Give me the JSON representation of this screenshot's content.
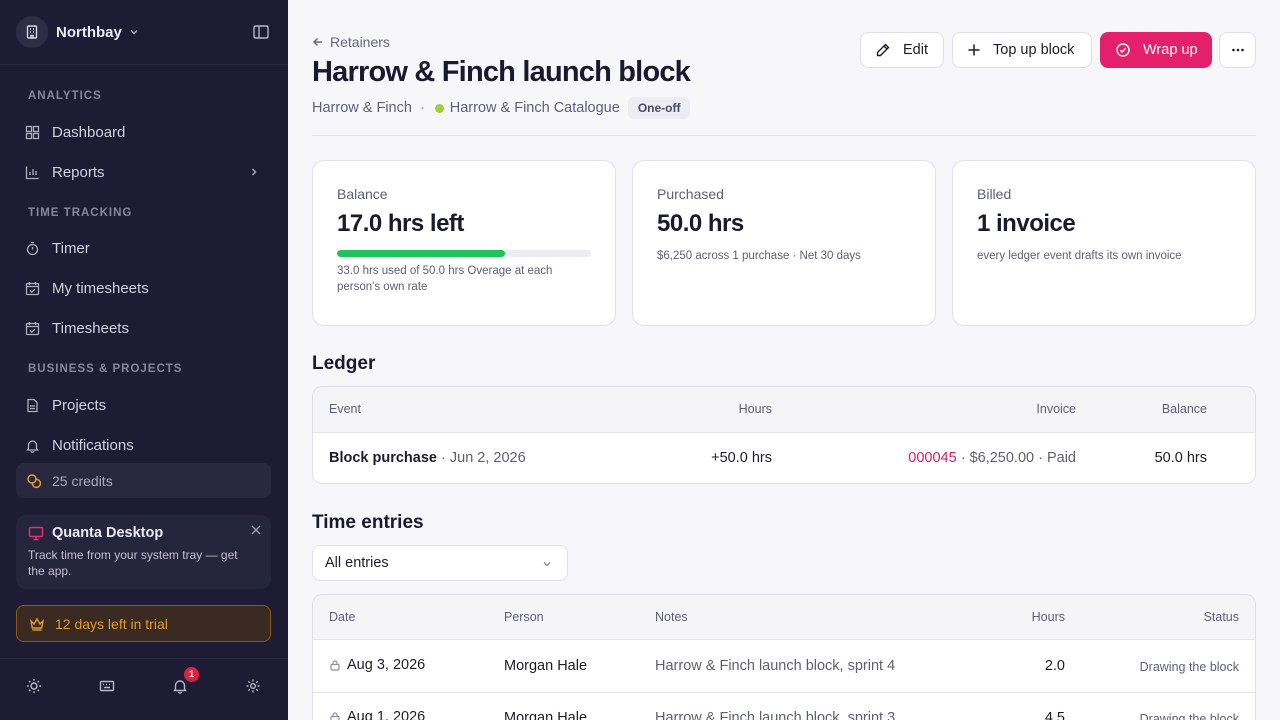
{
  "sidebar": {
    "workspace": "Northbay",
    "sections": [
      "ANALYTICS",
      "TIME TRACKING",
      "BUSINESS & PROJECTS"
    ],
    "items": [
      {
        "label": "Dashboard",
        "icon": "dashboard-icon"
      },
      {
        "label": "Reports",
        "icon": "chart-icon"
      },
      {
        "label": "Timer",
        "icon": "stopwatch-icon"
      },
      {
        "label": "My timesheets",
        "icon": "calendar-check-icon"
      },
      {
        "label": "Timesheets",
        "icon": "calendar-check-icon"
      },
      {
        "label": "Projects",
        "icon": "document-icon"
      },
      {
        "label": "Notifications",
        "icon": "bell-icon"
      }
    ],
    "credits": "25 credits",
    "promo": {
      "title": "Quanta Desktop",
      "text": "Track time from your system tray — get the app."
    },
    "trial": "12 days left in trial",
    "notification_count": "1",
    "colors": {
      "background": "#1d1c34",
      "accent": "#e8306a",
      "trial": "#e39a2e"
    }
  },
  "header": {
    "back_label": "Retainers",
    "title": "Harrow & Finch launch block",
    "client": "Harrow & Finch",
    "separator": "·",
    "project": "Harrow & Finch Catalogue",
    "type_pill": "One-off",
    "buttons": {
      "edit": "Edit",
      "top_up": "Top up block",
      "wrap_up": "Wrap up"
    },
    "primary_color": "#e5206a"
  },
  "cards": {
    "balance": {
      "label": "Balance",
      "value": "17.0 hrs left",
      "used_fraction": 0.66,
      "sub": "33.0 hrs used of 50.0 hrs   Overage at each person's own rate"
    },
    "purchased": {
      "label": "Purchased",
      "value": "50.0 hrs",
      "sub": "$6,250 across 1 purchase · Net 30 days"
    },
    "billed": {
      "label": "Billed",
      "value": "1 invoice",
      "sub": "every ledger event drafts its own invoice"
    }
  },
  "ledger": {
    "title": "Ledger",
    "columns": {
      "event": "Event",
      "hours": "Hours",
      "invoice": "Invoice",
      "balance": "Balance"
    },
    "rows": [
      {
        "event": "Block purchase",
        "date": "· Jun 2, 2026",
        "hours": "+50.0 hrs",
        "invoice_no": "000045",
        "invoice_rest": "· $6,250.00 · Paid",
        "balance": "50.0 hrs"
      }
    ]
  },
  "time_entries": {
    "title": "Time entries",
    "filter": "All entries",
    "columns": {
      "date": "Date",
      "person": "Person",
      "notes": "Notes",
      "hours": "Hours",
      "status": "Status"
    },
    "rows": [
      {
        "date": "Aug 3, 2026",
        "person": "Morgan Hale",
        "notes": "Harrow & Finch launch block, sprint 4",
        "hours": "2.0",
        "status": "Drawing the block"
      },
      {
        "date": "Aug 1, 2026",
        "person": "Morgan Hale",
        "notes": "Harrow & Finch launch block, sprint 3",
        "hours": "4.5",
        "status": "Drawing the block"
      }
    ]
  }
}
